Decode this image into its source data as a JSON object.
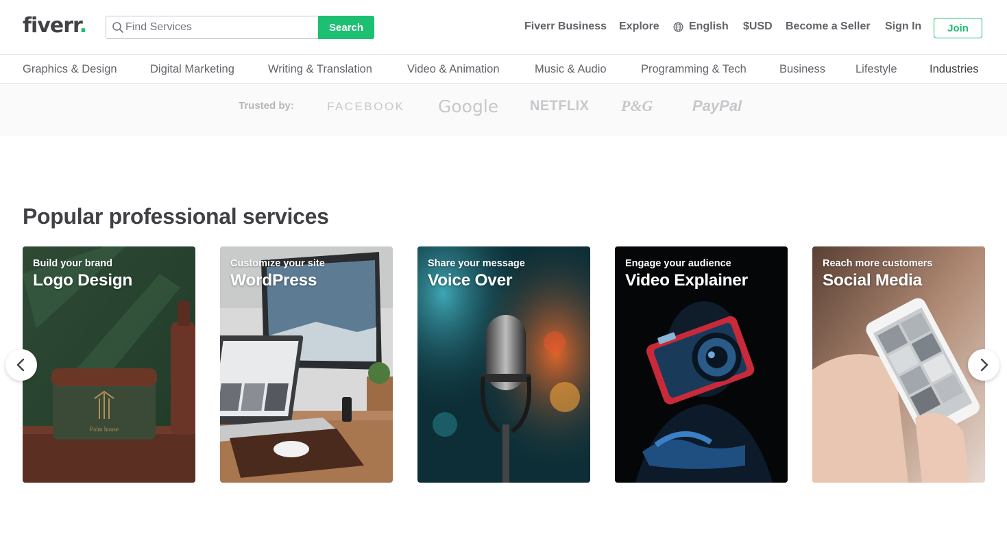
{
  "header": {
    "logo_text": "fiverr",
    "logo_dot": ".",
    "search_placeholder": "Find Services",
    "search_button": "Search",
    "nav": {
      "business": "Fiverr Business",
      "explore": "Explore",
      "language": "English",
      "currency": "$USD",
      "become_seller": "Become a Seller",
      "sign_in": "Sign In",
      "join": "Join"
    }
  },
  "categories": [
    "Graphics & Design",
    "Digital Marketing",
    "Writing & Translation",
    "Video & Animation",
    "Music & Audio",
    "Programming & Tech",
    "Business",
    "Lifestyle",
    "Industries"
  ],
  "trusted": {
    "label": "Trusted by:",
    "brands": [
      "FACEBOOK",
      "Google",
      "NETFLIX",
      "P&G",
      "PayPal"
    ]
  },
  "section": {
    "title": "Popular professional services",
    "cards": [
      {
        "subtitle": "Build your brand",
        "title": "Logo Design"
      },
      {
        "subtitle": "Customize your site",
        "title": "WordPress"
      },
      {
        "subtitle": "Share your message",
        "title": "Voice Over"
      },
      {
        "subtitle": "Engage your audience",
        "title": "Video Explainer"
      },
      {
        "subtitle": "Reach more customers",
        "title": "Social Media"
      }
    ]
  },
  "icons": {
    "search": "search-icon",
    "globe": "globe-icon",
    "prev": "chevron-left-icon",
    "next": "chevron-right-icon"
  },
  "colors": {
    "brand_green": "#1dbf73",
    "text_dark": "#404145",
    "text_muted": "#62646a"
  }
}
